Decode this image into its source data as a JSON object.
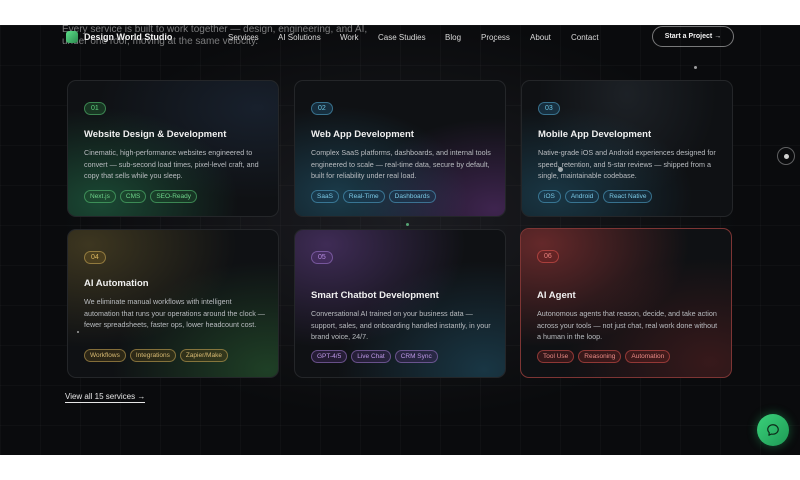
{
  "intro": {
    "ghost_text": "Every service is built to work together — design, engineering, and AI, under one roof, moving at the same velocity."
  },
  "nav": {
    "logo": "Design World Studio",
    "links": [
      "Services",
      "AI Solutions",
      "Work",
      "Case Studies",
      "Blog",
      "Process",
      "About",
      "Contact"
    ],
    "cta": "Start a Project →"
  },
  "cards": [
    {
      "num": "01",
      "title": "Website Design & Development",
      "desc": "Cinematic, high-performance websites engineered to convert — sub-second load times, pixel-level craft, and copy that sells while you sleep.",
      "tags": [
        "Next.js",
        "CMS",
        "SEO-Ready"
      ],
      "accent": "#3fbf63"
    },
    {
      "num": "02",
      "title": "Web App Development",
      "desc": "Complex SaaS platforms, dashboards, and internal tools engineered to scale — real-time data, secure by default, built for reliability under real load.",
      "tags": [
        "SaaS",
        "Real-Time",
        "Dashboards"
      ],
      "accent": "#3fa7c9"
    },
    {
      "num": "03",
      "title": "Mobile App Development",
      "desc": "Native-grade iOS and Android experiences designed for speed, retention, and 5-star reviews — shipped from a single, maintainable codebase.",
      "tags": [
        "iOS",
        "Android",
        "React Native"
      ],
      "accent": "#3fa7c9"
    },
    {
      "num": "04",
      "title": "AI Automation",
      "desc": "We eliminate manual workflows with intelligent automation that runs your operations around the clock — fewer spreadsheets, faster ops, lower headcount cost.",
      "tags": [
        "Workflows",
        "Integrations",
        "Zapier/Make"
      ],
      "accent": "#c9a24a"
    },
    {
      "num": "05",
      "title": "Smart Chatbot Development",
      "desc": "Conversational AI trained on your business data — support, sales, and onboarding handled instantly, in your brand voice, 24/7.",
      "tags": [
        "GPT-4/5",
        "Live Chat",
        "CRM Sync"
      ],
      "accent": "#9a6bd1"
    },
    {
      "num": "06",
      "title": "AI Agent",
      "desc": "Autonomous agents that reason, decide, and take action across your tools — not just chat, real work done without a human in the loop.",
      "tags": [
        "Tool Use",
        "Reasoning",
        "Automation"
      ],
      "accent": "#d9534f"
    }
  ],
  "view_all": "View all 15 services →",
  "colors": {
    "background": "#0a0b0d",
    "chat_button": "#2fbf6a"
  }
}
